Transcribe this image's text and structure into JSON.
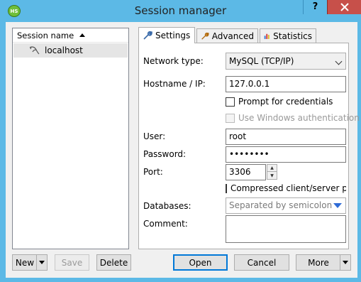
{
  "window": {
    "title": "Session manager",
    "help_label": "?",
    "app_icon_text": "HS"
  },
  "sessions": {
    "column_header": "Session name",
    "items": [
      {
        "label": "localhost",
        "icon": "dolphin-icon"
      }
    ]
  },
  "tabs": [
    {
      "label": "Settings",
      "icon": "wrench-icon",
      "active": true
    },
    {
      "label": "Advanced",
      "icon": "wrench-orange-icon",
      "active": false
    },
    {
      "label": "Statistics",
      "icon": "bar-chart-icon",
      "active": false
    }
  ],
  "settings": {
    "network_type_label": "Network type:",
    "network_type_value": "MySQL (TCP/IP)",
    "hostname_label": "Hostname / IP:",
    "hostname_value": "127.0.0.1",
    "prompt_credentials_label": "Prompt for credentials",
    "prompt_credentials_checked": false,
    "windows_auth_label": "Use Windows authentication",
    "windows_auth_checked": false,
    "windows_auth_enabled": false,
    "user_label": "User:",
    "user_value": "root",
    "password_label": "Password:",
    "password_value": "••••••••",
    "port_label": "Port:",
    "port_value": "3306",
    "compressed_label": "Compressed client/server protocol",
    "compressed_checked": false,
    "databases_label": "Databases:",
    "databases_placeholder": "Separated by semicolon",
    "comment_label": "Comment:",
    "comment_value": ""
  },
  "buttons": {
    "new": "New",
    "save": "Save",
    "delete": "Delete",
    "open": "Open",
    "cancel": "Cancel",
    "more": "More"
  },
  "colors": {
    "title_bar": "#5cb9e6",
    "close_button": "#c7504a",
    "selection": "#e5e5e5",
    "focus_border": "#0078d7"
  }
}
